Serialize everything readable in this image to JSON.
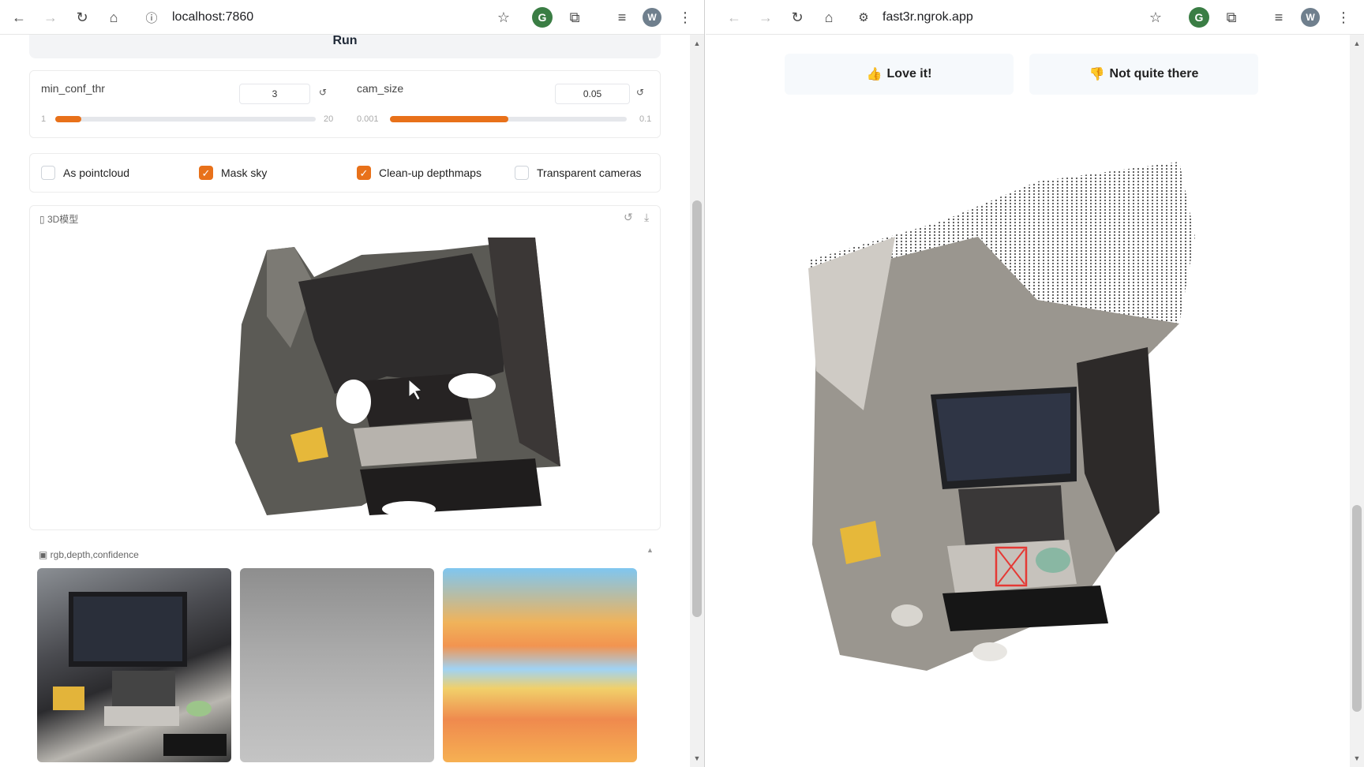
{
  "left_window": {
    "url": "localhost:7860",
    "run_label": "Run",
    "sliders": [
      {
        "label": "min_conf_thr",
        "value": "3",
        "min": "1",
        "max": "20",
        "fraction": 0.1
      },
      {
        "label": "cam_size",
        "value": "0.05",
        "min": "0.001",
        "max": "0.1",
        "fraction": 0.5
      }
    ],
    "checkboxes": [
      {
        "label": "As pointcloud",
        "checked": false
      },
      {
        "label": "Mask sky",
        "checked": true
      },
      {
        "label": "Clean-up depthmaps",
        "checked": true
      },
      {
        "label": "Transparent cameras",
        "checked": false
      }
    ],
    "model_panel_label": "3D模型",
    "gallery_label": "rgb,depth,confidence"
  },
  "right_window": {
    "url": "fast3r.ngrok.app",
    "love_label": "Love it!",
    "not_quite_label": "Not quite there"
  },
  "profile_initial": "W",
  "colors": {
    "accent": "#e8711a"
  }
}
